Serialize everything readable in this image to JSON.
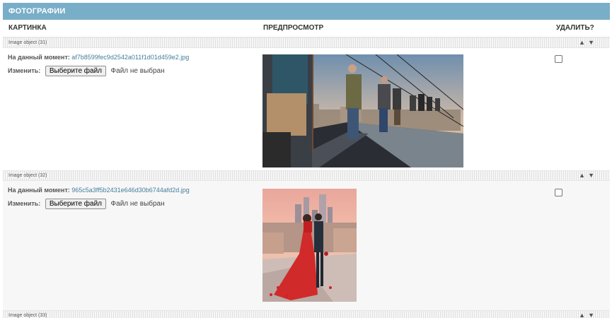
{
  "module": {
    "caption": "Фотографии",
    "headers": [
      "Картинка",
      "Предпросмотр",
      "Удалить?"
    ]
  },
  "rows": [
    {
      "object_label": "Image object (31)",
      "current_label": "На данный момент:",
      "current_file": "af7b8599fec9d2542a011f1d01d459e2.jpg",
      "change_label": "Изменить:",
      "choose_button": "Выберите файл",
      "file_status": "Файл не выбран",
      "delete_checked": false,
      "image": "rooftop-group-walking-photo"
    },
    {
      "object_label": "Image object (32)",
      "current_label": "На данный момент:",
      "current_file": "965c5a3ff5b2431e646d30b6744afd2d.jpg",
      "change_label": "Изменить:",
      "choose_button": "Выберите файл",
      "file_status": "Файл не выбран",
      "delete_checked": false,
      "image": "rooftop-couple-red-dress-photo"
    },
    {
      "object_label": "Image object (33)"
    }
  ],
  "colors": {
    "caption_bg": "#79aec8",
    "link": "#447e9b"
  },
  "icons": {
    "move_up": "▲",
    "move_down": "▼"
  }
}
